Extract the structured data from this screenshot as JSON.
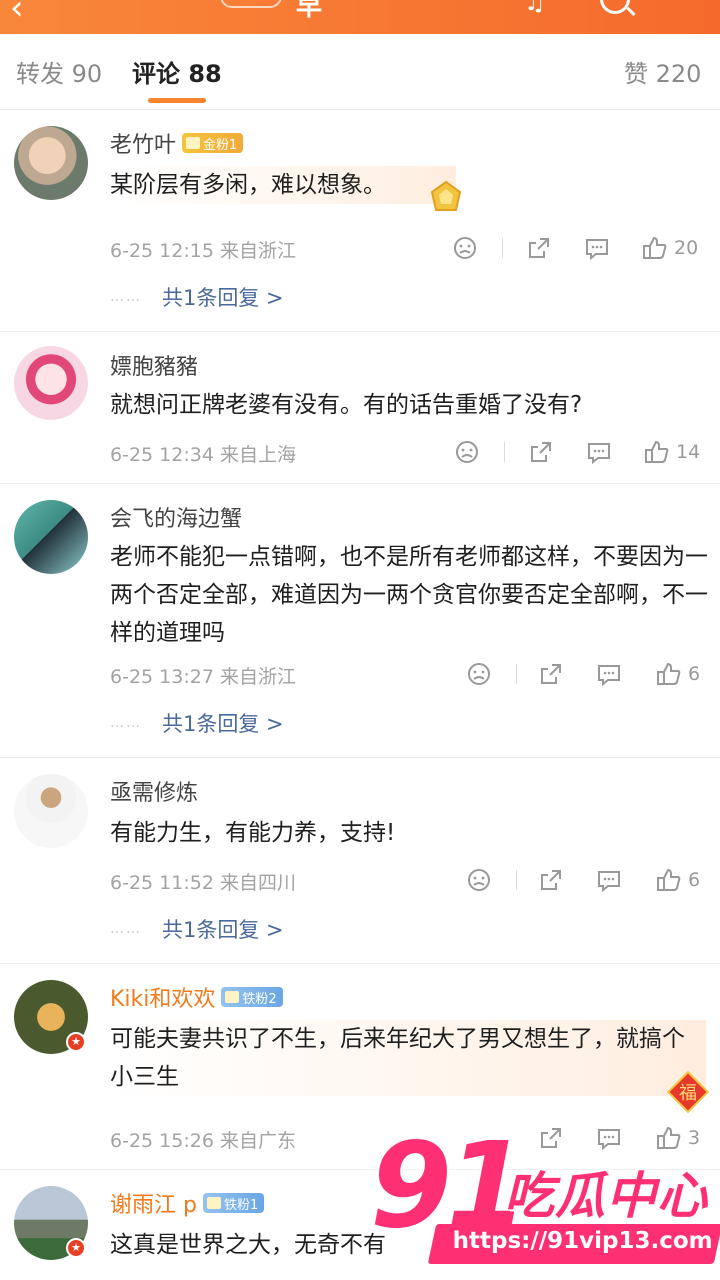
{
  "header": {
    "title": "早"
  },
  "tabs": [
    {
      "label": "转发 90"
    },
    {
      "label": "评论 88"
    },
    {
      "label": "赞 220"
    }
  ],
  "comments": [
    {
      "name": "老竹叶",
      "badge": "金粉1",
      "text": "某阶层有多闲，难以想象。",
      "meta": "6-25 12:15  来自浙江",
      "likes": "20",
      "replies": "共1条回复 >"
    },
    {
      "name": "嫖胞豬豬",
      "text": "就想问正牌老婆有没有。有的话告重婚了没有?",
      "meta": "6-25 12:34  来自上海",
      "likes": "14"
    },
    {
      "name": "会飞的海边蟹",
      "text": "老师不能犯一点错啊，也不是所有老师都这样，不要因为一两个否定全部，难道因为一两个贪官你要否定全部啊，不一样的道理吗",
      "meta": "6-25 13:27  来自浙江",
      "likes": "6",
      "replies": "共1条回复 >"
    },
    {
      "name": "亟需修炼",
      "text": "有能力生，有能力养，支持!",
      "meta": "6-25 11:52  来自四川",
      "likes": "6",
      "replies": "共1条回复 >"
    },
    {
      "name": "Kiki和欢欢",
      "badge": "铁粉2",
      "text": "可能夫妻共识了不生，后来年纪大了男又想生了，就搞个小三生",
      "meta": "6-25 15:26  来自广东",
      "likes": "3",
      "deco_text": "福"
    },
    {
      "name": "谢雨江 p",
      "badge": "铁粉1",
      "text": "这真是世界之大，无奇不有"
    }
  ],
  "watermark": {
    "number": "91",
    "cn": "吃瓜中心",
    "url": "https://91vip13.com"
  },
  "colors": {
    "accent": "#f7842e",
    "link": "#4a6a9c",
    "watermark": "#ff2f73"
  }
}
